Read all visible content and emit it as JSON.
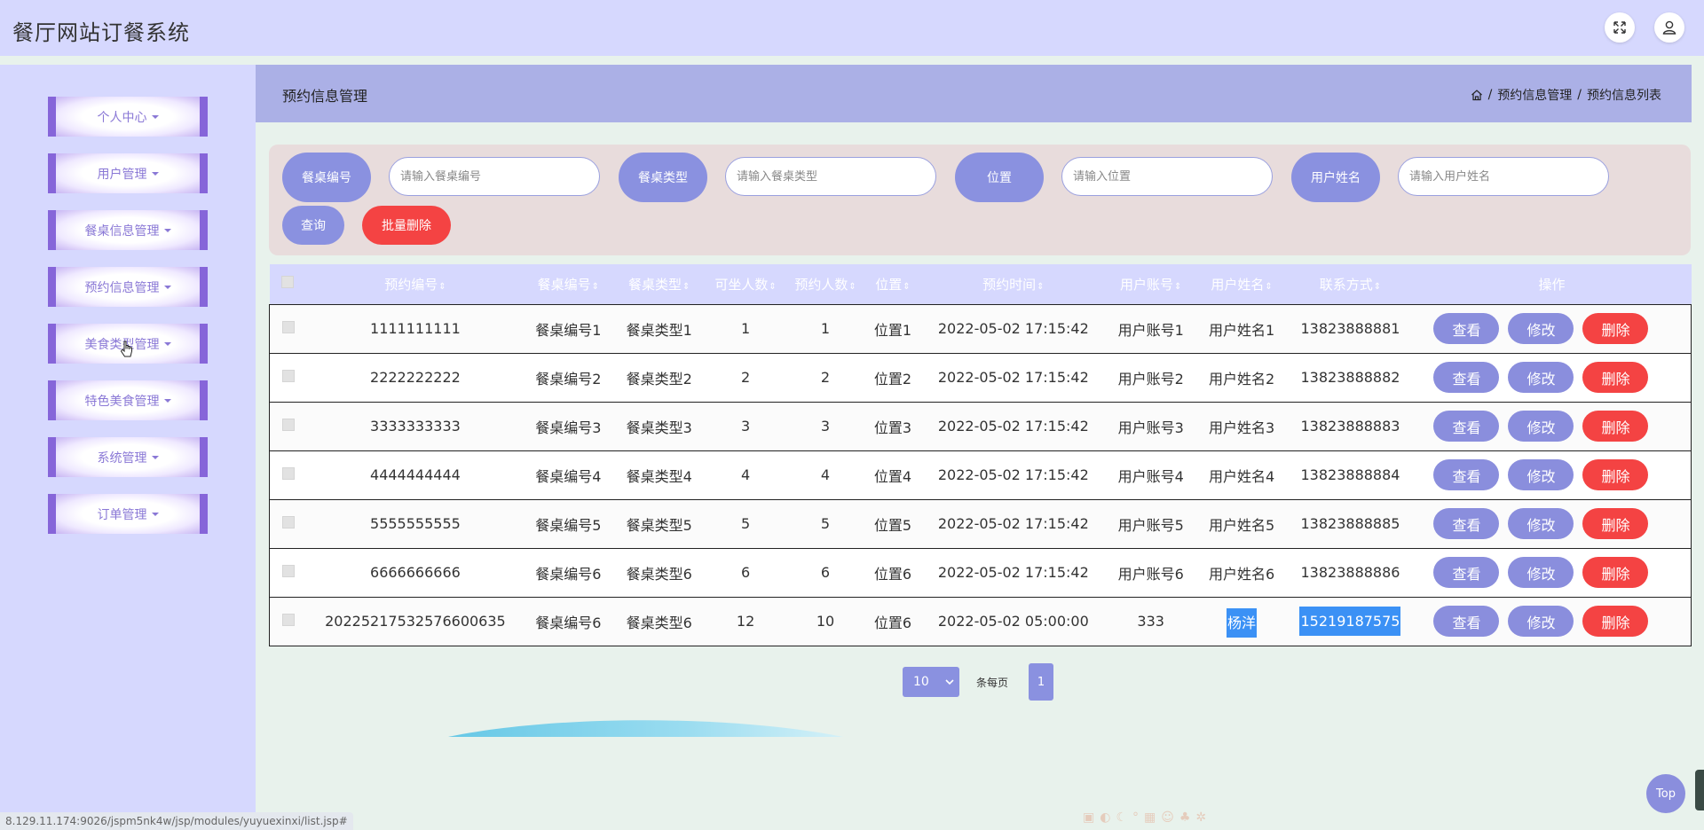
{
  "app": {
    "title": "餐厅网站订餐系统"
  },
  "header": {
    "fullscreen_icon": "expand-icon",
    "user_icon": "user-icon"
  },
  "sidebar": {
    "items": [
      {
        "label": "个人中心"
      },
      {
        "label": "用户管理"
      },
      {
        "label": "餐桌信息管理"
      },
      {
        "label": "预约信息管理"
      },
      {
        "label": "美食类型管理"
      },
      {
        "label": "特色美食管理"
      },
      {
        "label": "系统管理"
      },
      {
        "label": "订单管理"
      }
    ]
  },
  "content": {
    "title": "预约信息管理",
    "breadcrumb": {
      "home_icon": "home-icon",
      "sep": "/",
      "level1": "预约信息管理",
      "level2": "预约信息列表"
    }
  },
  "search": {
    "fields": [
      {
        "label": "餐桌编号",
        "placeholder": "请输入餐桌编号"
      },
      {
        "label": "餐桌类型",
        "placeholder": "请输入餐桌类型"
      },
      {
        "label": "位置",
        "placeholder": "请输入位置"
      },
      {
        "label": "用户姓名",
        "placeholder": "请输入用户姓名"
      }
    ],
    "query_label": "查询",
    "batch_delete_label": "批量删除"
  },
  "table": {
    "sort_glyph": "⇕",
    "columns": [
      "预约编号",
      "餐桌编号",
      "餐桌类型",
      "可坐人数",
      "预约人数",
      "位置",
      "预约时间",
      "用户账号",
      "用户姓名",
      "联系方式",
      "操作"
    ],
    "rows": [
      [
        "1111111111",
        "餐桌编号1",
        "餐桌类型1",
        "1",
        "1",
        "位置1",
        "2022-05-02 17:15:42",
        "用户账号1",
        "用户姓名1",
        "13823888881"
      ],
      [
        "2222222222",
        "餐桌编号2",
        "餐桌类型2",
        "2",
        "2",
        "位置2",
        "2022-05-02 17:15:42",
        "用户账号2",
        "用户姓名2",
        "13823888882"
      ],
      [
        "3333333333",
        "餐桌编号3",
        "餐桌类型3",
        "3",
        "3",
        "位置3",
        "2022-05-02 17:15:42",
        "用户账号3",
        "用户姓名3",
        "13823888883"
      ],
      [
        "4444444444",
        "餐桌编号4",
        "餐桌类型4",
        "4",
        "4",
        "位置4",
        "2022-05-02 17:15:42",
        "用户账号4",
        "用户姓名4",
        "13823888884"
      ],
      [
        "5555555555",
        "餐桌编号5",
        "餐桌类型5",
        "5",
        "5",
        "位置5",
        "2022-05-02 17:15:42",
        "用户账号5",
        "用户姓名5",
        "13823888885"
      ],
      [
        "6666666666",
        "餐桌编号6",
        "餐桌类型6",
        "6",
        "6",
        "位置6",
        "2022-05-02 17:15:42",
        "用户账号6",
        "用户姓名6",
        "13823888886"
      ],
      [
        "20225217532576600635",
        "餐桌编号6",
        "餐桌类型6",
        "12",
        "10",
        "位置6",
        "2022-05-02 05:00:00",
        "333",
        "杨洋",
        "15219187575"
      ]
    ],
    "actions": {
      "view": "查看",
      "edit": "修改",
      "delete": "删除"
    }
  },
  "pagination": {
    "page_size": "10",
    "per_page_label": "条每页",
    "current_page": "1"
  },
  "status_url": "8.129.11.174:9026/jspm5nk4w/jsp/modules/yuyuexinxi/list.jsp#",
  "back_to_top": "Top",
  "colors": {
    "accent": "#8a91e0",
    "danger": "#f44343",
    "selection": "#3b91f5",
    "menu_border": "#8665d9"
  }
}
